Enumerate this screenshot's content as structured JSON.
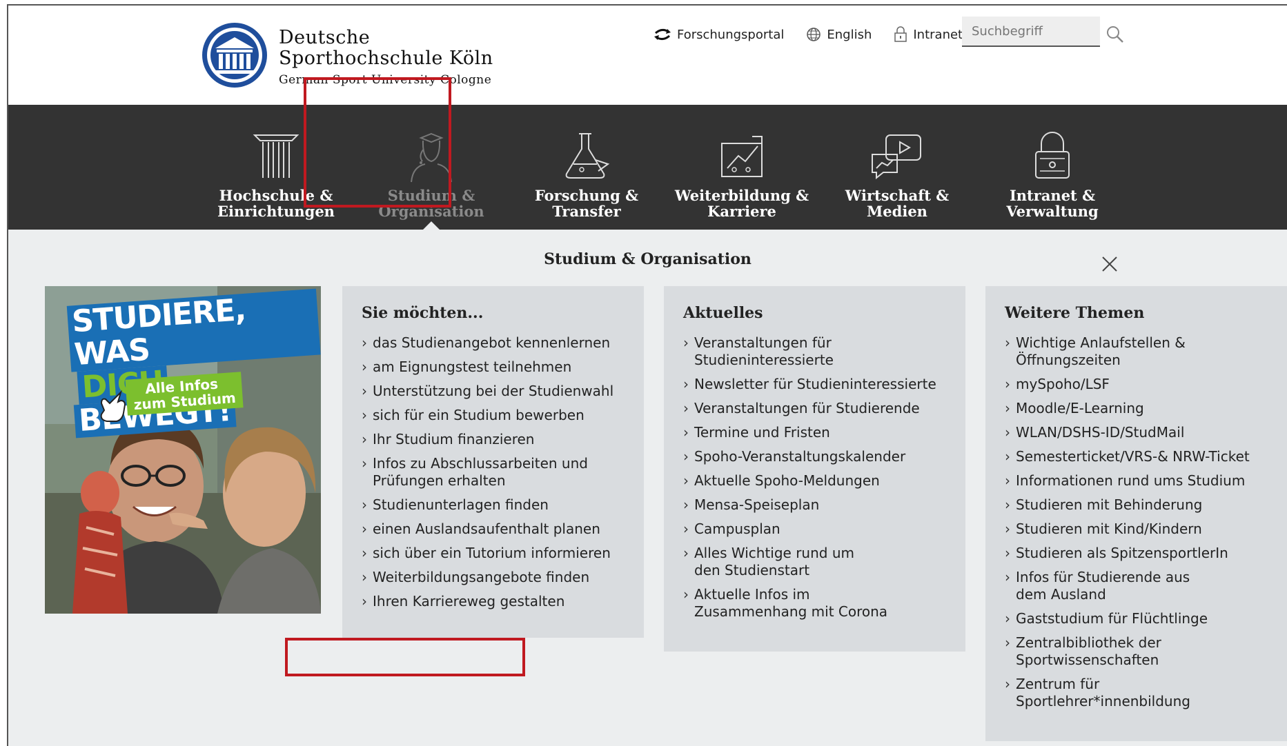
{
  "brand": {
    "line1": "Deutsche",
    "line2": "Sporthochschule Köln",
    "line3": "German Sport University Cologne"
  },
  "toplinks": {
    "forschungsportal": "Forschungsportal",
    "english": "English",
    "intranet": "Intranet"
  },
  "search": {
    "placeholder": "Suchbegriff"
  },
  "nav": {
    "items": [
      {
        "label_1": "Hochschule &",
        "label_2": "Einrichtungen",
        "icon": "column-icon"
      },
      {
        "label_1": "Studium &",
        "label_2": "Organisation",
        "icon": "student-icon",
        "active": true
      },
      {
        "label_1": "Forschung &",
        "label_2": "Transfer",
        "icon": "flask-icon"
      },
      {
        "label_1": "Weiterbildung &",
        "label_2": "Karriere",
        "icon": "career-icon"
      },
      {
        "label_1": "Wirtschaft &",
        "label_2": "Medien",
        "icon": "media-icon"
      },
      {
        "label_1": "Intranet &",
        "label_2": "Verwaltung",
        "icon": "lock-icon"
      }
    ]
  },
  "mega": {
    "title": "Studium & Organisation",
    "promo": {
      "headline_1": "STUDIERE, WAS",
      "headline_2a": "DICH",
      "headline_2b": "BEWEGT!",
      "badge_1": "Alle Infos",
      "badge_2": "zum Studium"
    },
    "col1": {
      "heading": "Sie möchten...",
      "items": [
        "das Studienangebot kennenlernen",
        "am Eignungstest teilnehmen",
        "Unterstützung bei der Studienwahl",
        "sich für ein Studium bewerben",
        "Ihr Studium finanzieren",
        "Infos zu Abschlussarbeiten und Prüfungen erhalten",
        "Studienunterlagen finden",
        "einen Auslandsaufenthalt planen",
        "sich über ein Tutorium informieren",
        "Weiterbildungsangebote finden",
        "Ihren Karriereweg gestalten"
      ]
    },
    "col2": {
      "heading": "Aktuelles",
      "items": [
        "Veranstaltungen für Studieninteressierte",
        "Newsletter für Studieninteressierte",
        "Veranstaltungen für Studierende",
        "Termine und Fristen",
        "Spoho-Veranstaltungskalender",
        "Aktuelle Spoho-Meldungen",
        "Mensa-Speiseplan",
        "Campusplan",
        "Alles Wichtige rund um den Studienstart",
        "Aktuelle Infos im Zusammenhang mit Corona"
      ]
    },
    "col3": {
      "heading": "Weitere Themen",
      "items": [
        "Wichtige Anlaufstellen & Öffnungszeiten",
        "mySpoho/LSF",
        "Moodle/E-Learning",
        "WLAN/DSHS-ID/StudMail",
        "Semesterticket/VRS-& NRW-Ticket",
        "Informationen rund ums Studium",
        "Studieren mit Behinderung",
        "Studieren mit Kind/Kindern",
        "Studieren als SpitzensportlerIn",
        "Infos für Studierende aus dem Ausland",
        "Gaststudium für Flüchtlinge",
        "Zentralbibliothek der Sportwissenschaften",
        "Zentrum für Sportlehrer*innenbildung"
      ]
    }
  },
  "colors": {
    "nav_bg": "#333333",
    "highlight": "#c01920",
    "logo_blue": "#1f4e9c",
    "promo_blue": "#1a6fb5",
    "promo_green": "#7cbf2e"
  }
}
